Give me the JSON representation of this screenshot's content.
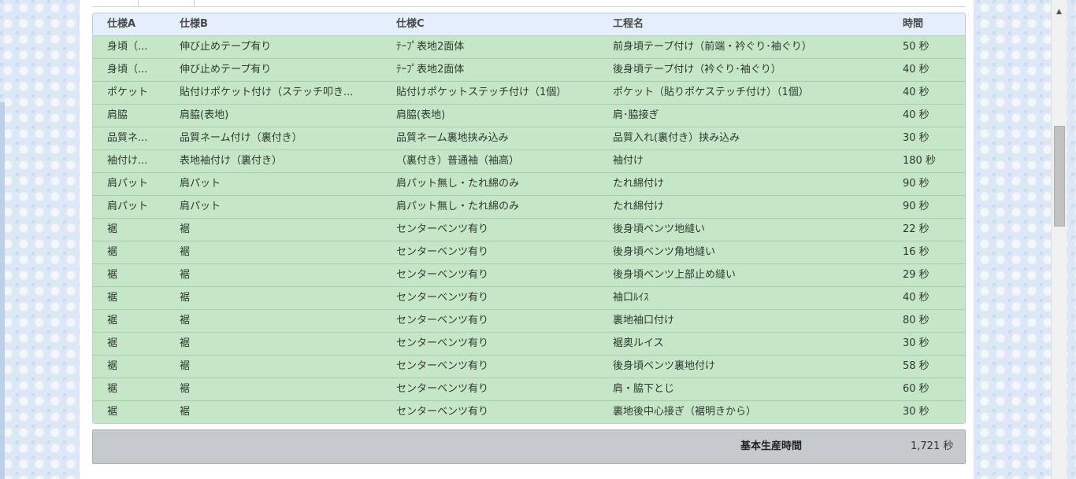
{
  "table": {
    "headers": {
      "spec_a": "仕様A",
      "spec_b": "仕様B",
      "spec_c": "仕様C",
      "process": "工程名",
      "time": "時間"
    },
    "rows": [
      {
        "spec_a": "身頃（...",
        "spec_b": "伸び止めテープ有り",
        "spec_c": "ﾃｰﾌﾟ表地2面体",
        "process": "前身頃テープ付け（前端・衿ぐり･袖ぐり）",
        "time": "50 秒"
      },
      {
        "spec_a": "身頃（...",
        "spec_b": "伸び止めテープ有り",
        "spec_c": "ﾃｰﾌﾟ表地2面体",
        "process": "後身頃テープ付け（衿ぐり･袖ぐり）",
        "time": "40 秒"
      },
      {
        "spec_a": "ポケット",
        "spec_b": "貼付けポケット付け（ステッチ叩き...",
        "spec_c": "貼付けポケットステッチ付け（1個）",
        "process": "ポケット（貼りポケステッチ付け）（1個）",
        "time": "40 秒"
      },
      {
        "spec_a": "肩脇",
        "spec_b": "肩脇(表地)",
        "spec_c": "肩脇(表地)",
        "process": "肩･脇接ぎ",
        "time": "40 秒"
      },
      {
        "spec_a": "品質ネ...",
        "spec_b": "品質ネーム付け（裏付き）",
        "spec_c": "品質ネーム裏地挟み込み",
        "process": "品質入れ(裏付き）挟み込み",
        "time": "30 秒"
      },
      {
        "spec_a": "袖付け...",
        "spec_b": "表地袖付け（裏付き）",
        "spec_c": "（裏付き）普通袖（袖高）",
        "process": "袖付け",
        "time": "180 秒"
      },
      {
        "spec_a": "肩パット",
        "spec_b": "肩パット",
        "spec_c": "肩パット無し・たれ綿のみ",
        "process": "たれ綿付け",
        "time": "90 秒"
      },
      {
        "spec_a": "肩パット",
        "spec_b": "肩パット",
        "spec_c": "肩パット無し・たれ綿のみ",
        "process": "たれ綿付け",
        "time": "90 秒"
      },
      {
        "spec_a": "裾",
        "spec_b": "裾",
        "spec_c": "センターベンツ有り",
        "process": "後身頃ベンツ地縫い",
        "time": "22 秒"
      },
      {
        "spec_a": "裾",
        "spec_b": "裾",
        "spec_c": "センターベンツ有り",
        "process": "後身頃ベンツ角地縫い",
        "time": "16 秒"
      },
      {
        "spec_a": "裾",
        "spec_b": "裾",
        "spec_c": "センターベンツ有り",
        "process": "後身頃ベンツ上部止め縫い",
        "time": "29 秒"
      },
      {
        "spec_a": "裾",
        "spec_b": "裾",
        "spec_c": "センターベンツ有り",
        "process": "袖口ﾙｲｽ",
        "time": "40 秒"
      },
      {
        "spec_a": "裾",
        "spec_b": "裾",
        "spec_c": "センターベンツ有り",
        "process": "裏地袖口付け",
        "time": "80 秒"
      },
      {
        "spec_a": "裾",
        "spec_b": "裾",
        "spec_c": "センターベンツ有り",
        "process": "裾奥ルイス",
        "time": "30 秒"
      },
      {
        "spec_a": "裾",
        "spec_b": "裾",
        "spec_c": "センターベンツ有り",
        "process": "後身頃ベンツ裏地付け",
        "time": "58 秒"
      },
      {
        "spec_a": "裾",
        "spec_b": "裾",
        "spec_c": "センターベンツ有り",
        "process": "肩・脇下とじ",
        "time": "60 秒"
      },
      {
        "spec_a": "裾",
        "spec_b": "裾",
        "spec_c": "センターベンツ有り",
        "process": "裏地後中心接ぎ（裾明きから）",
        "time": "30 秒"
      }
    ]
  },
  "summary": {
    "label": "基本生産時間",
    "value": "1,721 秒"
  },
  "icons": {
    "scroll_up": "chevron-up-icon"
  },
  "colors": {
    "row_bg": "#c6e6c8",
    "header_bg": "#e4effb",
    "total_bg": "#c5cacd"
  }
}
